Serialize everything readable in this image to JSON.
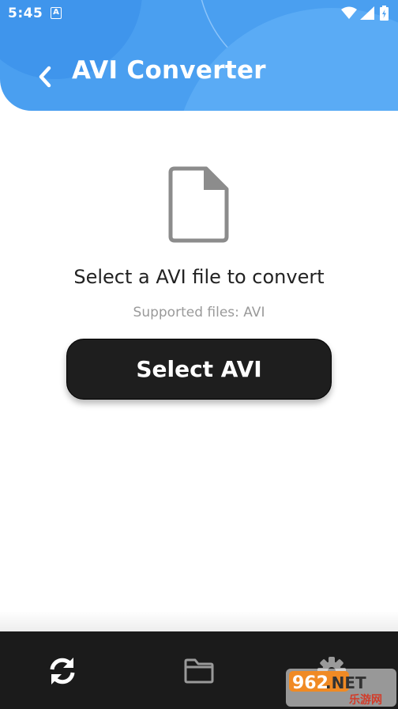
{
  "status_bar": {
    "time": "5:45",
    "notification_icon": "a-icon",
    "icons": [
      "wifi-icon",
      "signal-icon",
      "battery-icon"
    ]
  },
  "header": {
    "back_icon": "chevron-left-icon",
    "title": "AVI Converter",
    "background_color": "#4a9ff0"
  },
  "main": {
    "icon": "file-icon",
    "prompt": "Select a AVI file to convert",
    "supported": "Supported files: AVI",
    "select_button_label": "Select AVI"
  },
  "bottom_nav": {
    "items": [
      {
        "id": "convert",
        "icon": "refresh-icon"
      },
      {
        "id": "files",
        "icon": "folder-icon"
      },
      {
        "id": "settings",
        "icon": "gear-icon"
      }
    ]
  },
  "watermark": {
    "primary": "962.NET",
    "secondary": "乐游网"
  }
}
